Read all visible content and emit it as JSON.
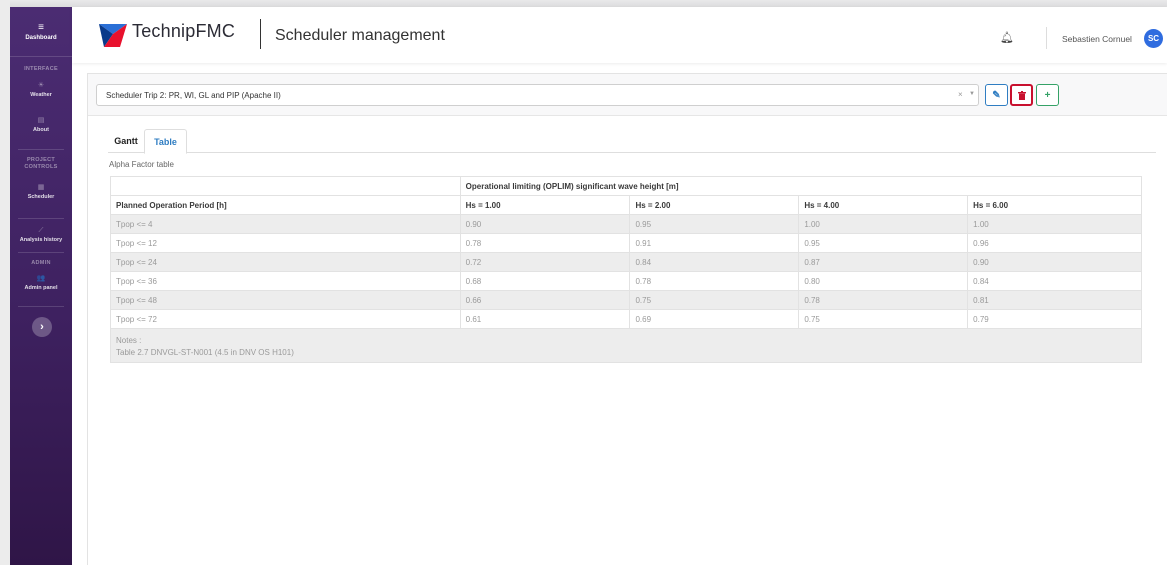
{
  "sidebar": {
    "dashboard_label": "Dashboard",
    "section_interface": "INTERFACE",
    "weather_label": "Weather",
    "about_label": "About",
    "section_project_controls": "PROJECT CONTROLS",
    "scheduler_label": "Scheduler",
    "analysis_history_label": "Analysis history",
    "section_admin": "ADMIN",
    "admin_panel_label": "Admin panel"
  },
  "header": {
    "brand": "TechnipFMC",
    "title": "Scheduler management",
    "user_name": "Sebastien Cornuel",
    "user_initials": "SC"
  },
  "selector": {
    "value": "Scheduler Trip 2: PR, WI, GL and PIP (Apache II)",
    "clear_glyph": "×",
    "arrow_glyph": "▼"
  },
  "actions": {
    "edit_glyph": "✎",
    "delete_glyph": "🗑",
    "add_glyph": "+"
  },
  "tabs": {
    "gantt": "Gantt",
    "table": "Table"
  },
  "table": {
    "caption": "Alpha Factor table",
    "group_header": "Operational limiting (OPLIM) significant wave height [m]",
    "row_header": "Planned Operation Period [h]",
    "columns": [
      "Hs = 1.00",
      "Hs = 2.00",
      "Hs = 4.00",
      "Hs = 6.00"
    ],
    "rows": [
      {
        "label": "Tpop <= 4",
        "values": [
          "0.90",
          "0.95",
          "1.00",
          "1.00"
        ]
      },
      {
        "label": "Tpop <= 12",
        "values": [
          "0.78",
          "0.91",
          "0.95",
          "0.96"
        ]
      },
      {
        "label": "Tpop <= 24",
        "values": [
          "0.72",
          "0.84",
          "0.87",
          "0.90"
        ]
      },
      {
        "label": "Tpop <= 36",
        "values": [
          "0.68",
          "0.78",
          "0.80",
          "0.84"
        ]
      },
      {
        "label": "Tpop <= 48",
        "values": [
          "0.66",
          "0.75",
          "0.78",
          "0.81"
        ]
      },
      {
        "label": "Tpop <= 72",
        "values": [
          "0.61",
          "0.69",
          "0.75",
          "0.79"
        ]
      }
    ],
    "notes_title": "Notes :",
    "notes_text": "Table 2.7 DNVGL-ST-N001 (4.5 in DNV OS H101)"
  },
  "colors": {
    "sidebar": "#4b2c72",
    "accent": "#2f7dc2",
    "danger": "#c8102e",
    "success": "#35a267",
    "avatar": "#2f6cdf"
  }
}
